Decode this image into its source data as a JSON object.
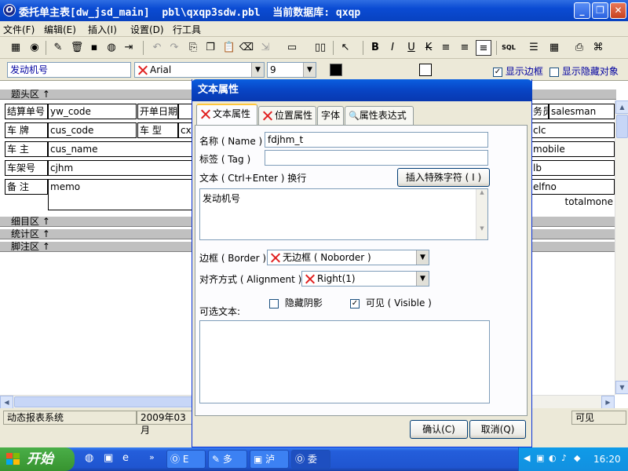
{
  "window": {
    "title": "委托单主表[dw_jsd_main]  pbl\\qxqp3sdw.pbl  当前数据库: qxqp",
    "app_icon": "O"
  },
  "menu": [
    "文件(F)",
    "编辑(E)",
    "插入(I)",
    "设置(D)",
    "行工具"
  ],
  "format_bar": {
    "text_value": "发动机号",
    "font": "Arial",
    "size": "9",
    "show_border_label": "显示边框",
    "show_border_checked": true,
    "show_hidden_label": "显示隐藏对象",
    "show_hidden_checked": false
  },
  "bands": {
    "header": "题头区 ↑",
    "detail": "细目区 ↑",
    "summary": "统计区 ↑",
    "footer": "脚注区 ↑"
  },
  "form": {
    "labels": {
      "settlement_no": "结算单号",
      "open_date": "开单日期",
      "plate": "车  牌",
      "model": "车  型",
      "owner": "车  主",
      "frame_no": "车架号",
      "remark": "备  注"
    },
    "fields": {
      "yw_code": "yw_code",
      "cus_code": "cus_code",
      "cus_name": "cus_name",
      "cjhm": "cjhm",
      "memo": "memo",
      "cx": "cx",
      "salesman_lbl": "务员",
      "salesman": "salesman",
      "clc": "clc",
      "mobile": "mobile",
      "lb": "lb",
      "telfno": "elfno",
      "totalmoney": "totalmone"
    }
  },
  "statusbar": {
    "system": "动态报表系统",
    "date": "2009年03月",
    "visible": "可见"
  },
  "dialog": {
    "title": "文本属性",
    "tabs": [
      "文本属性",
      "位置属性",
      "字体",
      "属性表达式"
    ],
    "name_label": "名称 ( Name )",
    "name_value": "fdjhm_t",
    "tag_label": "标签 ( Tag )",
    "tag_value": "",
    "text_label": "文本 ( Ctrl+Enter ) 换行",
    "insert_special_label": "插入特殊字符 ( I )",
    "text_value": "发动机号",
    "border_label": "边框 ( Border )",
    "border_value": "无边框 ( Noborder )",
    "align_label": "对齐方式 ( Alignment )",
    "align_value": "Right(1)",
    "hide_shadow_label": "隐藏阴影",
    "hide_shadow_checked": false,
    "visible_label": "可见 ( Visible )",
    "visible_checked": true,
    "optional_text_label": "可选文本:",
    "optional_text_value": "",
    "ok_label": "确认(C)",
    "cancel_label": "取消(Q)"
  },
  "taskbar": {
    "start_label": "开始",
    "tasks": [
      "E",
      "多",
      "泸",
      "委"
    ],
    "clock": "16:20"
  },
  "colors": {
    "titlebar": "#0a4bd3",
    "toolbar_bg": "#ece9d8",
    "xp_green": "#37932f",
    "error_x": "#e02020"
  }
}
